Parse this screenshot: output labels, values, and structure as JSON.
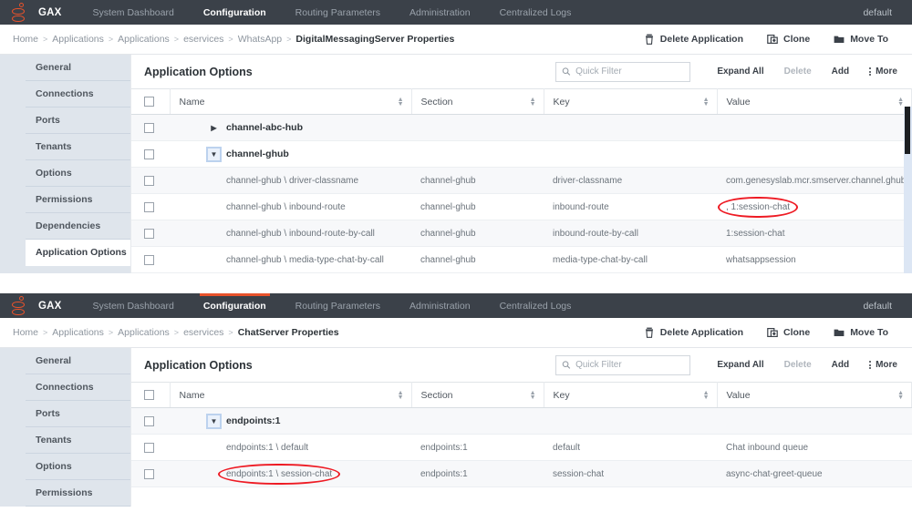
{
  "brand": "GAX",
  "nav": {
    "tabs": [
      {
        "label": "System Dashboard",
        "active": false
      },
      {
        "label": "Configuration",
        "active": true
      },
      {
        "label": "Routing Parameters",
        "active": false
      },
      {
        "label": "Administration",
        "active": false
      },
      {
        "label": "Centralized Logs",
        "active": false
      }
    ],
    "user": "default"
  },
  "icons": {
    "logo": "genesys-logo-icon",
    "search": "search-icon",
    "delete_app": "trash-icon",
    "clone": "copy-icon",
    "move_to": "folder-icon",
    "more": "kebab-menu-icon",
    "expanded": "caret-down-icon",
    "collapsed": "caret-right-icon",
    "sort": "sort-arrows-icon"
  },
  "colors": {
    "navbar_bg": "#3b4149",
    "accent_orange": "#e8522b",
    "sidebar_bg": "#dfe5ec",
    "annotation_red": "#ee1b24",
    "row_stripe": "#f7f8fa"
  },
  "panels": [
    {
      "breadcrumb": [
        "Home",
        "Applications",
        "Applications",
        "eservices",
        "WhatsApp",
        "DigitalMessagingServer Properties"
      ],
      "actions": [
        {
          "label": "Delete Application",
          "icon": "trash-icon"
        },
        {
          "label": "Clone",
          "icon": "copy-icon"
        },
        {
          "label": "Move To",
          "icon": "folder-icon"
        }
      ],
      "sidebar": [
        {
          "label": "General",
          "active": false
        },
        {
          "label": "Connections",
          "active": false
        },
        {
          "label": "Ports",
          "active": false
        },
        {
          "label": "Tenants",
          "active": false
        },
        {
          "label": "Options",
          "active": false
        },
        {
          "label": "Permissions",
          "active": false
        },
        {
          "label": "Dependencies",
          "active": false
        },
        {
          "label": "Application Options",
          "active": true
        }
      ],
      "content_title": "Application Options",
      "toolbar": {
        "filter_placeholder": "Quick Filter",
        "filter_value": "",
        "expand_all": "Expand All",
        "delete": "Delete",
        "add": "Add",
        "more": "More"
      },
      "columns": [
        "Name",
        "Section",
        "Key",
        "Value"
      ],
      "rows": [
        {
          "type": "group",
          "expanded": false,
          "name": "channel-abc-hub",
          "section": "",
          "key": "",
          "value": ""
        },
        {
          "type": "group",
          "expanded": true,
          "focused": true,
          "name": "channel-ghub",
          "section": "",
          "key": "",
          "value": ""
        },
        {
          "type": "child",
          "name": "channel-ghub \\ driver-classname",
          "section": "channel-ghub",
          "key": "driver-classname",
          "value": "com.genesyslab.mcr.smserver.channel.ghub.drv.GHubDri..."
        },
        {
          "type": "child",
          "name": "channel-ghub \\ inbound-route",
          "section": "channel-ghub",
          "key": "inbound-route",
          "value": ", 1:session-chat",
          "value_annotated": true
        },
        {
          "type": "child",
          "name": "channel-ghub \\ inbound-route-by-call",
          "section": "channel-ghub",
          "key": "inbound-route-by-call",
          "value": "1:session-chat"
        },
        {
          "type": "child",
          "name": "channel-ghub \\ media-type-chat-by-call",
          "section": "channel-ghub",
          "key": "media-type-chat-by-call",
          "value": "whatsappsession"
        }
      ]
    },
    {
      "breadcrumb": [
        "Home",
        "Applications",
        "Applications",
        "eservices",
        "ChatServer Properties"
      ],
      "actions": [
        {
          "label": "Delete Application",
          "icon": "trash-icon"
        },
        {
          "label": "Clone",
          "icon": "copy-icon"
        },
        {
          "label": "Move To",
          "icon": "folder-icon"
        }
      ],
      "sidebar": [
        {
          "label": "General",
          "active": false
        },
        {
          "label": "Connections",
          "active": false
        },
        {
          "label": "Ports",
          "active": false
        },
        {
          "label": "Tenants",
          "active": false
        },
        {
          "label": "Options",
          "active": false
        },
        {
          "label": "Permissions",
          "active": false
        }
      ],
      "content_title": "Application Options",
      "toolbar": {
        "filter_placeholder": "Quick Filter",
        "filter_value": "",
        "expand_all": "Expand All",
        "delete": "Delete",
        "add": "Add",
        "more": "More"
      },
      "columns": [
        "Name",
        "Section",
        "Key",
        "Value"
      ],
      "rows": [
        {
          "type": "group",
          "expanded": true,
          "focused": true,
          "name": "endpoints:1",
          "section": "",
          "key": "",
          "value": ""
        },
        {
          "type": "child",
          "name": "endpoints:1 \\ default",
          "section": "endpoints:1",
          "key": "default",
          "value": "Chat inbound queue"
        },
        {
          "type": "child",
          "name": "endpoints:1 \\ session-chat",
          "section": "endpoints:1",
          "key": "session-chat",
          "value": "async-chat-greet-queue",
          "name_annotated": true
        }
      ]
    }
  ]
}
